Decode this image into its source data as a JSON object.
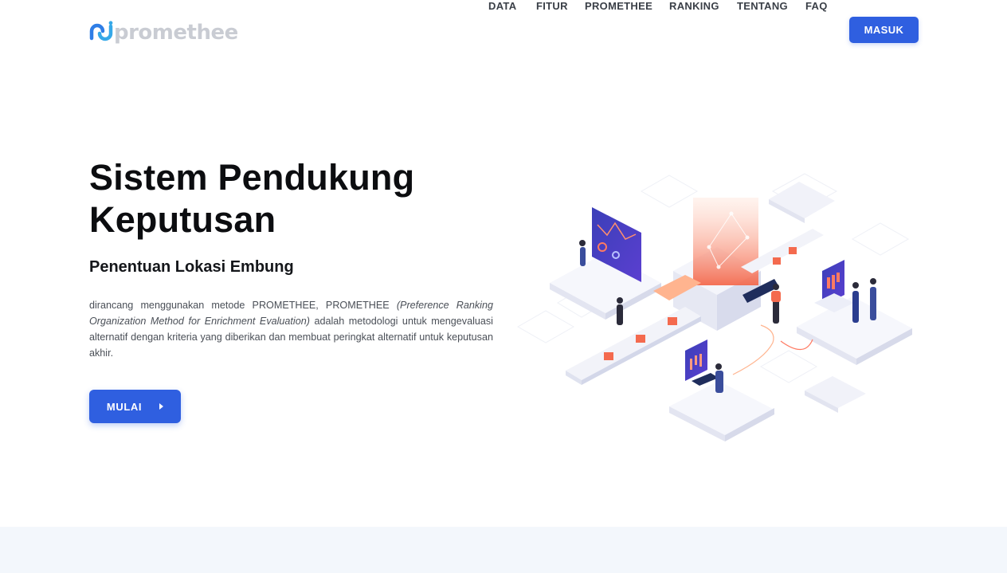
{
  "brand": {
    "logo_text": "promethee",
    "colors": {
      "mark_blue": "#2f7ee6",
      "mark_teal": "#35a8e8",
      "text": "#c9ccd3"
    }
  },
  "nav": {
    "items": [
      {
        "label": "DATA"
      },
      {
        "label": "FITUR"
      },
      {
        "label": "PROMETHEE"
      },
      {
        "label": "RANKING"
      },
      {
        "label": "TENTANG"
      },
      {
        "label": "FAQ"
      }
    ],
    "login_label": "MASUK"
  },
  "hero": {
    "title_line1": "Sistem Pendukung",
    "title_line2": "Keputusan",
    "subtitle": "Penentuan Lokasi Embung",
    "desc_part1": "dirancang menggunakan metode PROMETHEE, PROMETHEE ",
    "desc_italic": "(Preference Ranking Organization Method for Enrichment Evaluation)",
    "desc_part2": " adalah metodologi untuk mengevaluasi alternatif dengan kriteria yang diberikan dan membuat peringkat alternatif untuk keputusan akhir.",
    "cta_label": "MULAI",
    "illustration": "isometric-data-platform-illustration"
  },
  "colors": {
    "primary": "#2f5fe0",
    "band": "#f3f7fc",
    "accent_orange": "#f46a4e"
  }
}
